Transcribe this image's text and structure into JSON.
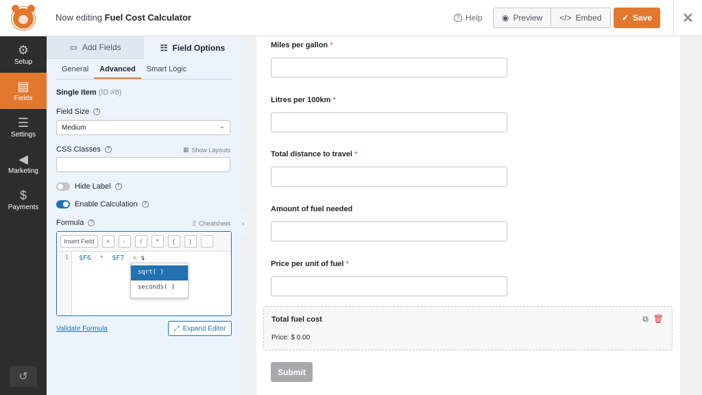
{
  "header": {
    "title_prefix": "Now editing",
    "title_form": "Fuel Cost Calculator",
    "help_label": "Help",
    "preview_label": "Preview",
    "embed_label": "Embed",
    "save_label": "Save",
    "accent_color": "#e27730"
  },
  "sidebar": {
    "items": [
      {
        "label": "Setup",
        "icon": "gear-icon"
      },
      {
        "label": "Fields",
        "icon": "fields-icon",
        "active": true
      },
      {
        "label": "Settings",
        "icon": "sliders-icon"
      },
      {
        "label": "Marketing",
        "icon": "megaphone-icon"
      },
      {
        "label": "Payments",
        "icon": "dollar-icon"
      }
    ]
  },
  "panel": {
    "tabs": [
      "Add Fields",
      "Field Options"
    ],
    "subtabs": [
      "General",
      "Advanced",
      "Smart Logic"
    ],
    "field_title": "Single Item",
    "field_id": "(ID #8)",
    "field_size_label": "Field Size",
    "field_size_value": "Medium",
    "css_classes_label": "CSS Classes",
    "show_layouts": "Show Layouts",
    "hide_label": "Hide Label",
    "enable_calculation": "Enable Calculation",
    "formula_label": "Formula",
    "cheatsheet": "Cheatsheet",
    "insert_field": "Insert Field",
    "operators": [
      "+",
      "-",
      "/",
      "*",
      "(",
      ")",
      "."
    ],
    "line_number": "1",
    "code": {
      "v1": "$F6",
      "op1": "*",
      "v2": "$F7",
      "op2": "+",
      "typed": "s"
    },
    "autocomplete": [
      "sqrt( )",
      "seconds( )"
    ],
    "validate": "Validate Formula",
    "expand": "Expand Editor"
  },
  "form": {
    "fields": [
      {
        "label": "Miles per gallon",
        "required": "*"
      },
      {
        "label": "Litres per 100km",
        "required": "*"
      },
      {
        "label": "Total distance to travel",
        "required": "*"
      },
      {
        "label": "Amount of fuel needed",
        "required": ""
      },
      {
        "label": "Price per unit of fuel",
        "required": "*"
      }
    ],
    "total_label": "Total fuel cost",
    "price_text": "Price: $ 0.00",
    "submit": "Submit"
  }
}
